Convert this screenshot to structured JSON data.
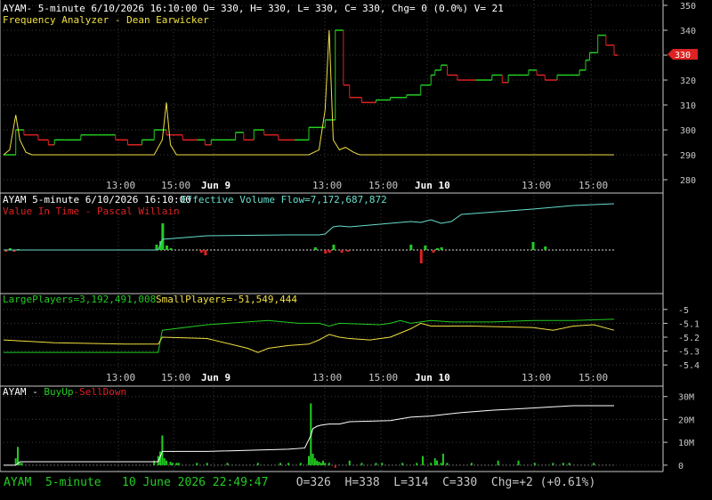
{
  "colors": {
    "background": "#000000",
    "separator": "#c8c8c8",
    "grid": "#3a3a3a",
    "up": "#22cc22",
    "down": "#dd2222",
    "indicator_yellow": "#f0e040",
    "cyan": "#66ddcc",
    "white": "#ffffff",
    "axis_text": "#c8c8c8",
    "price_tag": "#dd2222"
  },
  "panel1": {
    "header": "AYAM- 5-minute 6/10/2026 16:10:00 O= 330, H= 330, L= 330, C= 330, Chg= 0 (0.0%) V= 21",
    "subheader": "Frequency Analyzer - Dean Earwicker",
    "price_tag": "330",
    "y_ticks": [
      "350",
      "340",
      "330",
      "320",
      "310",
      "300",
      "290",
      "280"
    ]
  },
  "panel2": {
    "header_left": "AYAM 5-minute  6/10/2026 16:10:00",
    "header_right": "Effective Volume Flow=7,172,687,872",
    "subheader": "Value In Time - Pascal Willain"
  },
  "panel3": {
    "large_label": "LargePlayers=3,192,491,008",
    "small_label": "SmallPlayers=-51,549,444",
    "y_ticks": [
      "-5",
      "-5.1",
      "-5.2",
      "-5.3",
      "-5.4"
    ]
  },
  "panel4": {
    "title_a": "AYAM - ",
    "title_b": "BuyUp",
    "title_c": "-SellDown",
    "y_ticks": [
      "30M",
      "20M",
      "10M",
      "0"
    ]
  },
  "x_axis": {
    "labels": [
      "13:00",
      "15:00",
      "Jun 9",
      "13:00",
      "15:00",
      "Jun 10",
      "13:00",
      "15:00"
    ]
  },
  "status": {
    "left": "AYAM  5-minute   10 June 2026 22:49:47",
    "right": "O=326  H=338  L=314  C=330  Chg=+2 (+0.61%)"
  },
  "chart_data": [
    {
      "type": "line",
      "title": "Price (step) with Frequency Analyzer",
      "ylim": [
        280,
        350
      ],
      "series": [
        {
          "name": "AYAM",
          "step": true,
          "x": [
            0,
            6,
            10,
            17,
            22,
            25,
            30,
            38,
            46,
            55,
            61,
            68,
            74,
            80,
            88,
            95,
            99,
            102,
            108,
            114,
            118,
            123,
            128,
            135,
            143,
            150,
            158,
            163,
            167,
            170,
            176,
            183,
            190,
            198,
            205,
            210,
            212,
            215,
            218,
            223,
            232,
            240,
            245,
            248,
            252,
            255,
            258,
            262,
            266,
            272,
            278,
            283,
            286,
            288,
            292,
            296,
            300
          ],
          "y": [
            290,
            300,
            298,
            296,
            294,
            296,
            296,
            298,
            298,
            296,
            294,
            296,
            300,
            298,
            296,
            296,
            294,
            296,
            296,
            299,
            296,
            300,
            298,
            296,
            296,
            301,
            304,
            340,
            318,
            313,
            311,
            312,
            313,
            314,
            318,
            322,
            324,
            326,
            322,
            320,
            320,
            322,
            319,
            322,
            322,
            322,
            324,
            322,
            320,
            322,
            322,
            324,
            328,
            331,
            338,
            334,
            330
          ]
        },
        {
          "name": "Frequency Analyzer",
          "x": [
            0,
            3,
            6,
            8,
            11,
            14,
            18,
            25,
            40,
            60,
            74,
            78,
            80,
            82,
            85,
            90,
            100,
            120,
            140,
            150,
            155,
            158,
            160,
            162,
            165,
            168,
            172,
            175,
            180,
            190,
            200,
            220,
            240,
            260,
            280,
            300
          ],
          "y": [
            290,
            292,
            306,
            296,
            291,
            290,
            290,
            290,
            290,
            290,
            290,
            296,
            311,
            294,
            290,
            290,
            290,
            290,
            290,
            290,
            292,
            308,
            340,
            296,
            292,
            293,
            291,
            290,
            290,
            290,
            290,
            290,
            290,
            290,
            290,
            290
          ]
        }
      ]
    },
    {
      "type": "line",
      "title": "Value In Time - Pascal Willain",
      "series": [
        {
          "name": "Effective Volume Flow",
          "x": [
            0,
            40,
            76,
            78,
            100,
            140,
            150,
            155,
            158,
            160,
            162,
            165,
            170,
            180,
            190,
            200,
            205,
            210,
            215,
            220,
            225,
            260,
            280,
            300
          ],
          "y": [
            0,
            0,
            0,
            12,
            16,
            17,
            17,
            17,
            18,
            22,
            26,
            27,
            26,
            28,
            30,
            32,
            31,
            34,
            30,
            32,
            40,
            46,
            50,
            52
          ]
        },
        {
          "name": "Value In Time",
          "x": [
            0,
            40,
            80,
            120,
            160,
            200,
            240,
            280,
            300
          ],
          "y": [
            0,
            0,
            0,
            0,
            0,
            0,
            0,
            0,
            0
          ]
        }
      ],
      "bars": {
        "x": [
          1,
          3,
          5,
          7,
          75,
          77,
          78,
          80,
          82,
          97,
          99,
          153,
          158,
          160,
          162,
          166,
          169,
          200,
          205,
          207,
          211,
          213,
          215,
          260,
          266
        ],
        "y": [
          -2,
          2,
          -2,
          1,
          6,
          10,
          30,
          5,
          2,
          -3,
          -6,
          3,
          -4,
          -3,
          6,
          -3,
          -2,
          6,
          -15,
          5,
          -3,
          2,
          3,
          9,
          4
        ]
      }
    },
    {
      "type": "line",
      "title": "LargePlayers / SmallPlayers",
      "ylim": [
        -5.45,
        -4.95
      ],
      "series": [
        {
          "name": "LargePlayers",
          "color": "#22cc22",
          "x": [
            0,
            76,
            78,
            100,
            130,
            145,
            155,
            160,
            165,
            185,
            190,
            195,
            200,
            205,
            210,
            220,
            240,
            260,
            280,
            300
          ],
          "y": [
            -5.31,
            -5.31,
            -5.15,
            -5.11,
            -5.08,
            -5.1,
            -5.1,
            -5.12,
            -5.1,
            -5.11,
            -5.1,
            -5.08,
            -5.1,
            -5.09,
            -5.08,
            -5.09,
            -5.09,
            -5.08,
            -5.08,
            -5.07
          ]
        },
        {
          "name": "SmallPlayers",
          "color": "#f0e040",
          "x": [
            0,
            25,
            60,
            76,
            78,
            100,
            120,
            125,
            130,
            140,
            150,
            155,
            160,
            165,
            170,
            180,
            190,
            200,
            205,
            210,
            230,
            260,
            270,
            280,
            290,
            300
          ],
          "y": [
            -5.22,
            -5.24,
            -5.25,
            -5.25,
            -5.2,
            -5.21,
            -5.28,
            -5.31,
            -5.28,
            -5.26,
            -5.25,
            -5.22,
            -5.18,
            -5.2,
            -5.21,
            -5.22,
            -5.2,
            -5.14,
            -5.1,
            -5.12,
            -5.12,
            -5.13,
            -5.15,
            -5.12,
            -5.11,
            -5.15
          ]
        }
      ]
    },
    {
      "type": "line",
      "title": "BuyUp-SellDown",
      "ylim": [
        -2,
        33
      ],
      "series": [
        {
          "name": "BuyUp-SellDown",
          "x": [
            0,
            6,
            8,
            76,
            78,
            80,
            100,
            140,
            148,
            151,
            152,
            154,
            156,
            160,
            165,
            170,
            190,
            200,
            210,
            215,
            225,
            240,
            260,
            270,
            280,
            300
          ],
          "y": [
            0,
            0,
            1.5,
            1.5,
            6,
            6,
            6,
            7,
            7.5,
            13,
            16,
            17,
            17.5,
            18,
            18,
            19,
            19.5,
            21,
            21.5,
            22,
            23,
            24,
            25,
            25.5,
            26,
            26
          ]
        }
      ],
      "bars": {
        "x": [
          6,
          7,
          8,
          9,
          74,
          76,
          77,
          78,
          79,
          80,
          82,
          83,
          85,
          86,
          95,
          100,
          110,
          125,
          136,
          140,
          146,
          150,
          151,
          152,
          153,
          154,
          155,
          156,
          157,
          158,
          160,
          170,
          176,
          183,
          186,
          196,
          203,
          206,
          210,
          212,
          213,
          215,
          216,
          218,
          230,
          243,
          253,
          261,
          270,
          275,
          278,
          290
        ],
        "y": [
          3,
          8,
          1,
          1,
          2,
          4,
          6,
          13,
          3,
          2,
          1.5,
          1,
          1,
          1,
          1,
          1,
          1,
          1,
          1,
          1,
          1,
          4,
          27,
          5,
          3,
          2,
          1.5,
          1,
          2,
          1,
          1,
          2,
          1,
          1,
          1,
          1,
          1,
          4,
          1,
          3,
          2,
          1,
          5,
          1,
          1,
          2,
          2,
          1,
          1,
          1,
          1,
          1
        ]
      }
    }
  ]
}
